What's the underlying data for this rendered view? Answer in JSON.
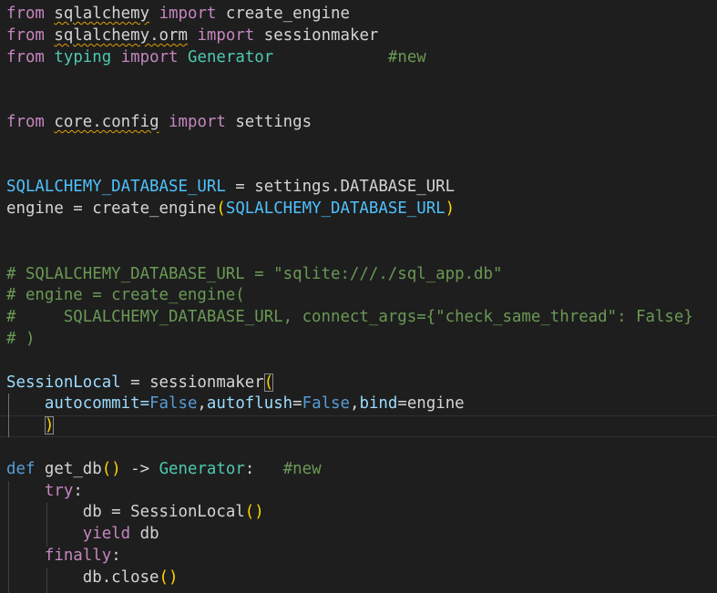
{
  "code_lines": [
    {
      "tokens": [
        {
          "t": "from",
          "c": "kw"
        },
        {
          "t": " ",
          "c": "text"
        },
        {
          "t": "sqlalchemy",
          "c": "text",
          "sq": true
        },
        {
          "t": " ",
          "c": "text"
        },
        {
          "t": "import",
          "c": "kw"
        },
        {
          "t": " create_engine",
          "c": "text"
        }
      ]
    },
    {
      "tokens": [
        {
          "t": "from",
          "c": "kw"
        },
        {
          "t": " ",
          "c": "text"
        },
        {
          "t": "sqlalchemy.orm",
          "c": "text",
          "sq": true
        },
        {
          "t": " ",
          "c": "text"
        },
        {
          "t": "import",
          "c": "kw"
        },
        {
          "t": " sessionmaker",
          "c": "text"
        }
      ]
    },
    {
      "tokens": [
        {
          "t": "from",
          "c": "kw"
        },
        {
          "t": " ",
          "c": "text"
        },
        {
          "t": "typing",
          "c": "type"
        },
        {
          "t": " ",
          "c": "text"
        },
        {
          "t": "import",
          "c": "kw"
        },
        {
          "t": " ",
          "c": "text"
        },
        {
          "t": "Generator",
          "c": "type"
        },
        {
          "t": "            ",
          "c": "text"
        },
        {
          "t": "#new",
          "c": "com"
        }
      ]
    },
    {
      "tokens": []
    },
    {
      "tokens": []
    },
    {
      "tokens": [
        {
          "t": "from",
          "c": "kw"
        },
        {
          "t": " ",
          "c": "text"
        },
        {
          "t": "core.config",
          "c": "text",
          "sq": true
        },
        {
          "t": " ",
          "c": "text"
        },
        {
          "t": "import",
          "c": "kw"
        },
        {
          "t": " settings",
          "c": "text"
        }
      ]
    },
    {
      "tokens": []
    },
    {
      "tokens": []
    },
    {
      "tokens": [
        {
          "t": "SQLALCHEMY_DATABASE_URL",
          "c": "const"
        },
        {
          "t": " = settings.DATABASE_URL",
          "c": "text"
        }
      ]
    },
    {
      "tokens": [
        {
          "t": "engine = ",
          "c": "text"
        },
        {
          "t": "create_engine",
          "c": "text"
        },
        {
          "t": "(",
          "c": "p1"
        },
        {
          "t": "SQLALCHEMY_DATABASE_URL",
          "c": "const"
        },
        {
          "t": ")",
          "c": "p1"
        }
      ]
    },
    {
      "tokens": []
    },
    {
      "tokens": []
    },
    {
      "tokens": [
        {
          "t": "# SQLALCHEMY_DATABASE_URL = \"sqlite:///./sql_app.db\"",
          "c": "com"
        }
      ]
    },
    {
      "tokens": [
        {
          "t": "# engine = create_engine(",
          "c": "com"
        }
      ]
    },
    {
      "tokens": [
        {
          "t": "#     SQLALCHEMY_DATABASE_URL, connect_args={\"check_same_thread\": False}",
          "c": "com"
        }
      ]
    },
    {
      "tokens": [
        {
          "t": "# )",
          "c": "com"
        }
      ]
    },
    {
      "tokens": []
    },
    {
      "tokens": [
        {
          "t": "SessionLocal",
          "c": "var"
        },
        {
          "t": " = ",
          "c": "text"
        },
        {
          "t": "sessionmaker",
          "c": "text"
        },
        {
          "t": "(",
          "c": "p1",
          "hl": true
        }
      ]
    },
    {
      "tokens": [
        {
          "t": "    autocommit=",
          "c": "var"
        },
        {
          "t": "False",
          "c": "bool"
        },
        {
          "t": ",",
          "c": "text"
        },
        {
          "t": "autoflush",
          "c": "var"
        },
        {
          "t": "=",
          "c": "text"
        },
        {
          "t": "False",
          "c": "bool"
        },
        {
          "t": ",",
          "c": "text"
        },
        {
          "t": "bind",
          "c": "var"
        },
        {
          "t": "=engine",
          "c": "text"
        }
      ]
    },
    {
      "tokens": [
        {
          "t": "    ",
          "c": "text"
        },
        {
          "t": ")",
          "c": "p1",
          "hl": true
        }
      ]
    },
    {
      "tokens": []
    },
    {
      "tokens": [
        {
          "t": "def",
          "c": "def"
        },
        {
          "t": " ",
          "c": "text"
        },
        {
          "t": "get_db",
          "c": "text"
        },
        {
          "t": "()",
          "c": "p1"
        },
        {
          "t": " -> ",
          "c": "text"
        },
        {
          "t": "Generator",
          "c": "type"
        },
        {
          "t": ":   ",
          "c": "text"
        },
        {
          "t": "#new",
          "c": "com"
        }
      ]
    },
    {
      "tokens": [
        {
          "t": "    ",
          "c": "text"
        },
        {
          "t": "try",
          "c": "kw"
        },
        {
          "t": ":",
          "c": "text"
        }
      ]
    },
    {
      "tokens": [
        {
          "t": "        db = ",
          "c": "text"
        },
        {
          "t": "SessionLocal",
          "c": "text"
        },
        {
          "t": "()",
          "c": "p1"
        }
      ]
    },
    {
      "tokens": [
        {
          "t": "        ",
          "c": "text"
        },
        {
          "t": "yield",
          "c": "kw"
        },
        {
          "t": " db",
          "c": "text"
        }
      ]
    },
    {
      "tokens": [
        {
          "t": "    ",
          "c": "text"
        },
        {
          "t": "finally",
          "c": "kw"
        },
        {
          "t": ":",
          "c": "text"
        }
      ]
    },
    {
      "tokens": [
        {
          "t": "        db.close",
          "c": "text"
        },
        {
          "t": "()",
          "c": "p1"
        }
      ]
    }
  ],
  "colors": {
    "background": "#1e1e1e",
    "keyword": "#c586c0",
    "def_keyword": "#569cd6",
    "type": "#4ec9b0",
    "variable": "#9cdcfe",
    "constant": "#4fc1ff",
    "comment": "#6a9955",
    "bracket": "#ffd700"
  }
}
